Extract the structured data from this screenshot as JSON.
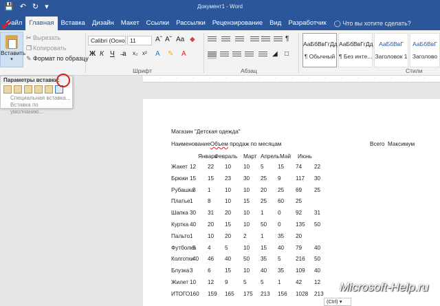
{
  "window": {
    "title": "Документ1 - Word"
  },
  "qat": {
    "save_icon": "save-icon",
    "undo_icon": "undo-icon",
    "redo_icon": "redo-icon"
  },
  "tabs": [
    {
      "label": "Файл"
    },
    {
      "label": "Главная"
    },
    {
      "label": "Вставка"
    },
    {
      "label": "Дизайн"
    },
    {
      "label": "Макет"
    },
    {
      "label": "Ссылки"
    },
    {
      "label": "Рассылки"
    },
    {
      "label": "Рецензирование"
    },
    {
      "label": "Вид"
    },
    {
      "label": "Разработчик"
    }
  ],
  "tell_me": "Что вы хотите сделать?",
  "clipboard": {
    "paste_label": "Вставить",
    "cut": "Вырезать",
    "copy": "Копировать",
    "format_painter": "Формат по образцу"
  },
  "font": {
    "name": "Calibri (Осно",
    "size": "11",
    "group_label": "Шрифт",
    "buttons": [
      "Ж",
      "К",
      "Ч"
    ]
  },
  "paragraph": {
    "group_label": "Абзац"
  },
  "styles": {
    "group_label": "Стили",
    "cards": [
      {
        "preview": "АаБбВвГгДд",
        "name": "¶ Обычный"
      },
      {
        "preview": "АаБбВвГгДд",
        "name": "¶ Без инте..."
      },
      {
        "preview": "АаБбВвГ",
        "name": "Заголовок 1"
      },
      {
        "preview": "АаБбВвГ",
        "name": "Заголово"
      }
    ]
  },
  "paste_menu": {
    "header": "Параметры вставки:",
    "special": "Специальная вставка...",
    "default": "Вставка по умолчанию..."
  },
  "document": {
    "title_line": "Магазин \"Детская одежда\"",
    "header_line": {
      "col1": "Наименование",
      "col2_spell": "Объем",
      "col2_rest": " продаж по месяцам",
      "total": "Всего",
      "max": "Максимум"
    },
    "months": [
      "Январь",
      "Февраль",
      "Март",
      "Апрель",
      "Май",
      "Июнь"
    ],
    "rows": [
      {
        "name": "Жакет",
        "vals": [
          "12",
          "22",
          "10",
          "10",
          "5",
          "15",
          "74",
          "22"
        ]
      },
      {
        "name": "Брюки",
        "vals": [
          "15",
          "15",
          "23",
          "30",
          "25",
          "9",
          "117",
          "30"
        ]
      },
      {
        "name": "Рубашка",
        "vals": [
          "3",
          "1",
          "10",
          "10",
          "20",
          "25",
          "69",
          "25"
        ]
      },
      {
        "name": "Платье",
        "vals": [
          "1",
          "8",
          "10",
          "15",
          "25",
          "60",
          "25",
          ""
        ]
      },
      {
        "name": "Шапка",
        "vals": [
          "30",
          "31",
          "20",
          "10",
          "1",
          "0",
          "92",
          "31"
        ]
      },
      {
        "name": "Куртка",
        "vals": [
          "40",
          "20",
          "15",
          "10",
          "50",
          "0",
          "135",
          "50"
        ]
      },
      {
        "name": "Пальто",
        "vals": [
          "1",
          "10",
          "20",
          "2",
          "1",
          "35",
          "20",
          ""
        ]
      },
      {
        "name": "Футболка",
        "vals": [
          "5",
          "4",
          "5",
          "10",
          "15",
          "40",
          "79",
          "40"
        ]
      },
      {
        "name": "Колготки",
        "vals": [
          "40",
          "46",
          "40",
          "50",
          "35",
          "5",
          "216",
          "50"
        ]
      },
      {
        "name": "Блузка",
        "vals": [
          "3",
          "6",
          "15",
          "10",
          "40",
          "35",
          "109",
          "40"
        ]
      },
      {
        "name": "Жилет",
        "vals": [
          "10",
          "12",
          "9",
          "5",
          "5",
          "1",
          "42",
          "12"
        ]
      },
      {
        "name": "ИТОГО",
        "vals": [
          "160",
          "159",
          "165",
          "175",
          "213",
          "156",
          "1028",
          "213"
        ]
      }
    ]
  },
  "ctrl_tag": "(Ctrl) ▾",
  "watermark": "Microsoft-Help.ru",
  "colors": {
    "accent": "#2b579a",
    "annotation_red": "#d42020"
  }
}
